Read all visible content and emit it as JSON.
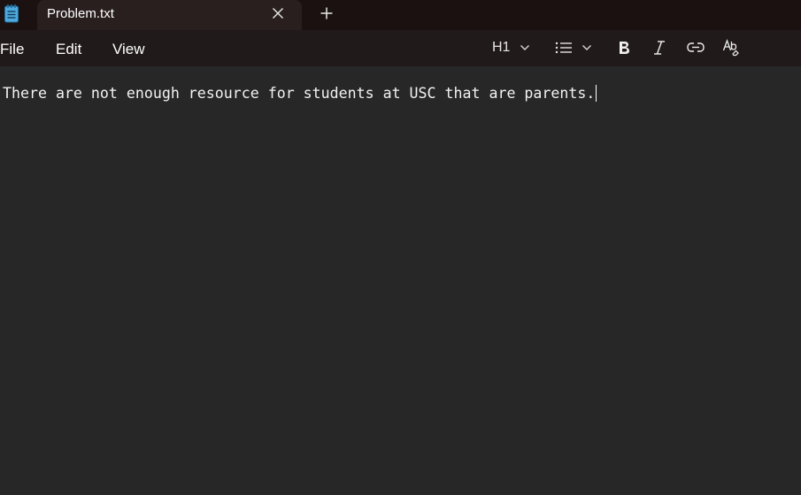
{
  "tab": {
    "title": "Problem.txt"
  },
  "icons": {
    "app": "notepad-icon",
    "close": "close-icon",
    "new_tab": "plus-icon",
    "list": "bulleted-list-icon",
    "bold": "bold-icon",
    "italic": "italic-icon",
    "link": "link-icon",
    "clear_format": "clear-formatting-icon",
    "chevron": "chevron-down-icon"
  },
  "menu": {
    "file": "File",
    "edit": "Edit",
    "view": "View"
  },
  "toolbar": {
    "heading": "H1"
  },
  "editor": {
    "content": "There are not enough resource for students at USC that are parents."
  },
  "colors": {
    "titlebar": "#1c1111",
    "tab_active": "#2a1f1f",
    "menubar": "#211a1a",
    "editor_bg": "#272727",
    "app_icon": "#5ab8e8"
  }
}
